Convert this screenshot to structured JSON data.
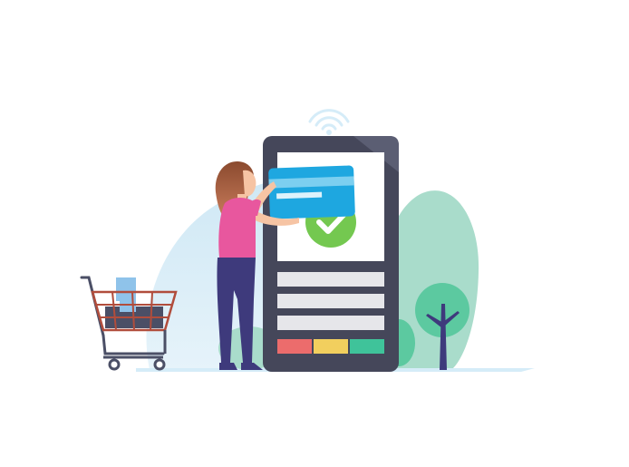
{
  "illustration": {
    "subject": "mobile-payment",
    "colors": {
      "background": "#ffffff",
      "sky_blob": "#cfe8f5",
      "bush": "#a9dccb",
      "tree": "#5cc9a0",
      "phone_body": "#45475a",
      "screen": "#ffffff",
      "card": "#1ea7e0",
      "check": "#74c850",
      "button_red": "#ec6c6c",
      "button_yellow": "#f2cf5e",
      "button_green": "#3fc39a",
      "shirt": "#e8579e",
      "pants": "#3e3a7c",
      "hair": "#8a4a2e",
      "skin": "#f6c4a4",
      "cart": "#4b4f66",
      "cart_basket": "#b14d3c"
    },
    "icons": [
      "wifi-signal-icon",
      "check-icon",
      "credit-card-icon",
      "shopping-cart-icon"
    ]
  }
}
